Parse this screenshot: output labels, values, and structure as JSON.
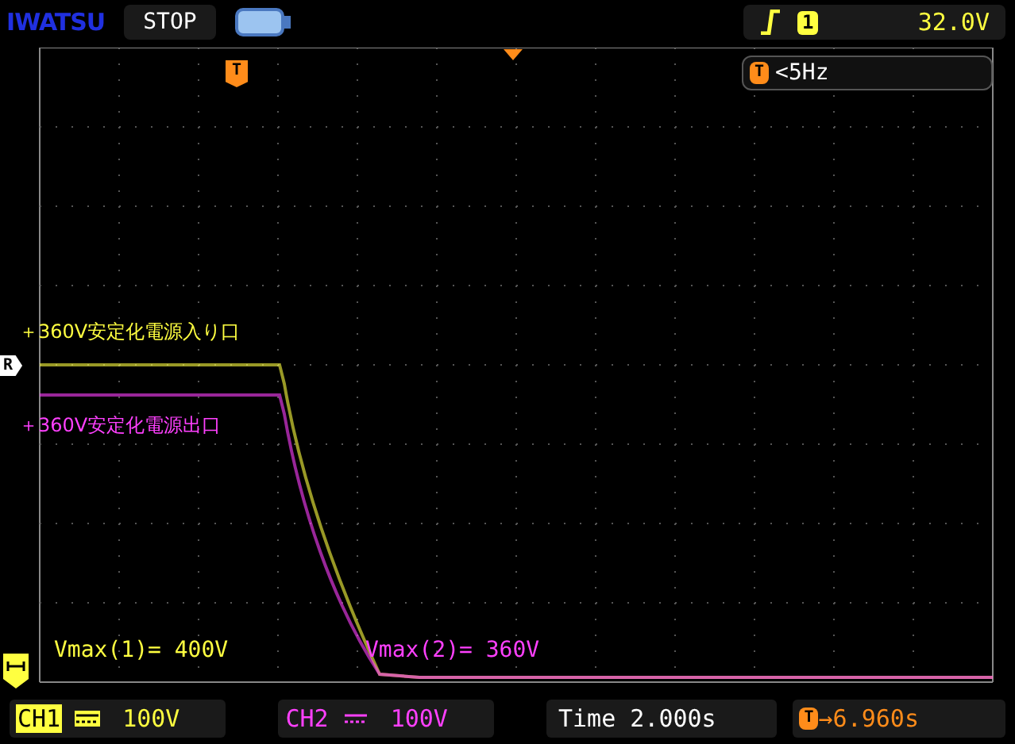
{
  "top_bar": {
    "brand": "IWATSU",
    "run_state": "STOP",
    "trigger": {
      "channel": "1",
      "level": "32.0V"
    }
  },
  "trigger_frequency": {
    "marker": "T",
    "text": "<5Hz"
  },
  "markers": {
    "trigger_marker": "T",
    "reference_marker": "R"
  },
  "traces": [
    {
      "label": "＋360V安定化電源入り口",
      "color": "#ffff40"
    },
    {
      "label": "＋360V安定化電源出口",
      "color": "#ff40ff"
    }
  ],
  "measurements": [
    {
      "text": "Vmax(1)= 400V",
      "color": "#ffff40"
    },
    {
      "text": "Vmax(2)= 360V",
      "color": "#ff40ff"
    }
  ],
  "bottom_bar": {
    "channels": [
      {
        "name": "CH1",
        "scale": "100V",
        "selected": true,
        "color": "#ffff40"
      },
      {
        "name": "CH2",
        "scale": "100V",
        "selected": false,
        "color": "#ff40ff"
      }
    ],
    "time": "Time 2.000s",
    "trigger_offset_marker": "T",
    "trigger_offset": "→6.960s"
  }
}
